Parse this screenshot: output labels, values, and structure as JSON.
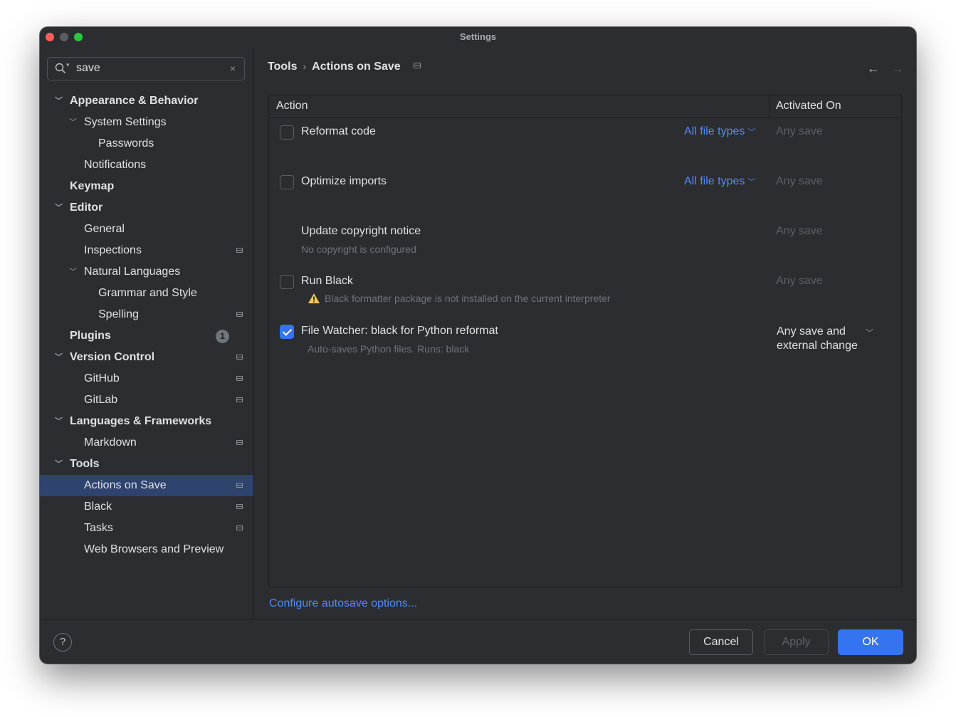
{
  "window": {
    "title": "Settings"
  },
  "search": {
    "value": "save",
    "clear_label": "×"
  },
  "tree": [
    {
      "label": "Appearance & Behavior",
      "bold": true,
      "level": 0,
      "chevron": "expanded",
      "proj": false
    },
    {
      "label": "System Settings",
      "bold": false,
      "level": 1,
      "chevron": "expanded",
      "proj": false
    },
    {
      "label": "Passwords",
      "bold": false,
      "level": 2,
      "chevron": "",
      "proj": false
    },
    {
      "label": "Notifications",
      "bold": false,
      "level": 1,
      "chevron": "",
      "proj": false
    },
    {
      "label": "Keymap",
      "bold": true,
      "level": 0,
      "chevron": "",
      "proj": false
    },
    {
      "label": "Editor",
      "bold": true,
      "level": 0,
      "chevron": "expanded",
      "proj": false
    },
    {
      "label": "General",
      "bold": false,
      "level": 1,
      "chevron": "",
      "proj": false
    },
    {
      "label": "Inspections",
      "bold": false,
      "level": 1,
      "chevron": "",
      "proj": true
    },
    {
      "label": "Natural Languages",
      "bold": false,
      "level": 1,
      "chevron": "expanded",
      "proj": false
    },
    {
      "label": "Grammar and Style",
      "bold": false,
      "level": 2,
      "chevron": "",
      "proj": false
    },
    {
      "label": "Spelling",
      "bold": false,
      "level": 2,
      "chevron": "",
      "proj": true
    },
    {
      "label": "Plugins",
      "bold": true,
      "level": 0,
      "chevron": "",
      "proj": false,
      "badge": "1"
    },
    {
      "label": "Version Control",
      "bold": true,
      "level": 0,
      "chevron": "expanded",
      "proj": true
    },
    {
      "label": "GitHub",
      "bold": false,
      "level": 1,
      "chevron": "",
      "proj": true
    },
    {
      "label": "GitLab",
      "bold": false,
      "level": 1,
      "chevron": "",
      "proj": true
    },
    {
      "label": "Languages & Frameworks",
      "bold": true,
      "level": 0,
      "chevron": "expanded",
      "proj": false
    },
    {
      "label": "Markdown",
      "bold": false,
      "level": 1,
      "chevron": "",
      "proj": true
    },
    {
      "label": "Tools",
      "bold": true,
      "level": 0,
      "chevron": "expanded",
      "proj": false
    },
    {
      "label": "Actions on Save",
      "bold": false,
      "level": 1,
      "chevron": "",
      "proj": true,
      "selected": true
    },
    {
      "label": "Black",
      "bold": false,
      "level": 1,
      "chevron": "",
      "proj": true
    },
    {
      "label": "Tasks",
      "bold": false,
      "level": 1,
      "chevron": "",
      "proj": true
    },
    {
      "label": "Web Browsers and Preview",
      "bold": false,
      "level": 1,
      "chevron": "",
      "proj": false
    }
  ],
  "breadcrumb": {
    "parent": "Tools",
    "current": "Actions on Save"
  },
  "table": {
    "headers": {
      "action": "Action",
      "activated_on": "Activated On"
    },
    "rows": {
      "reformat": {
        "title": "Reformat code",
        "file_types": "All file types",
        "activated_on": "Any save",
        "checked": false
      },
      "optimize": {
        "title": "Optimize imports",
        "file_types": "All file types",
        "activated_on": "Any save",
        "checked": false
      },
      "copyright": {
        "title": "Update copyright notice",
        "subtitle": "No copyright is configured",
        "activated_on": "Any save"
      },
      "black": {
        "title": "Run Black",
        "warning": "Black formatter package is not installed on the current interpreter",
        "activated_on": "Any save",
        "checked": false
      },
      "watcher": {
        "title": "File Watcher: black for Python reformat",
        "subtitle": "Auto-saves Python files. Runs: black",
        "activated_on": "Any save and external change",
        "checked": true
      }
    }
  },
  "config_link": "Configure autosave options...",
  "footer": {
    "help": "?",
    "cancel": "Cancel",
    "apply": "Apply",
    "ok": "OK"
  },
  "colors": {
    "accent": "#3574f0",
    "link": "#548af7",
    "selection": "#2e436e",
    "background": "#2b2d30",
    "warning": "#f2c55c"
  }
}
